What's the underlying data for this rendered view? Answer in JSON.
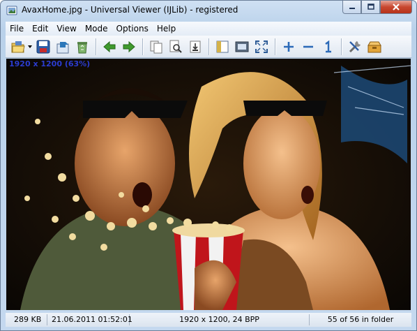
{
  "window": {
    "title": "AvaxHome.jpg - Universal Viewer (IJLib) - registered"
  },
  "menu": [
    "File",
    "Edit",
    "View",
    "Mode",
    "Options",
    "Help"
  ],
  "toolbar": {
    "icons": [
      "open-icon",
      "open-dropdown-icon",
      "save-icon",
      "reload-icon",
      "recycle-bin-icon",
      "previous-icon",
      "next-icon",
      "copy-icon",
      "print-preview-icon",
      "export-icon",
      "fit-window-icon",
      "slideshow-icon",
      "fullscreen-icon",
      "zoom-in-icon",
      "zoom-out-icon",
      "zoom-original-icon",
      "settings-icon",
      "plugins-icon"
    ]
  },
  "viewer": {
    "overlay_info": "1920 x 1200 (63%)"
  },
  "status": {
    "file_size": "289 KB",
    "date": "21.06.2011 01:52:01",
    "dimensions": "1920 x 1200, 24 BPP",
    "position": "55 of 56 in folder"
  },
  "colors": {
    "overlay_text": "#2b3ccf",
    "title_gradient": "#b9d1ea",
    "close_button": "#c8472f",
    "arrows": "#3f9a2e"
  }
}
